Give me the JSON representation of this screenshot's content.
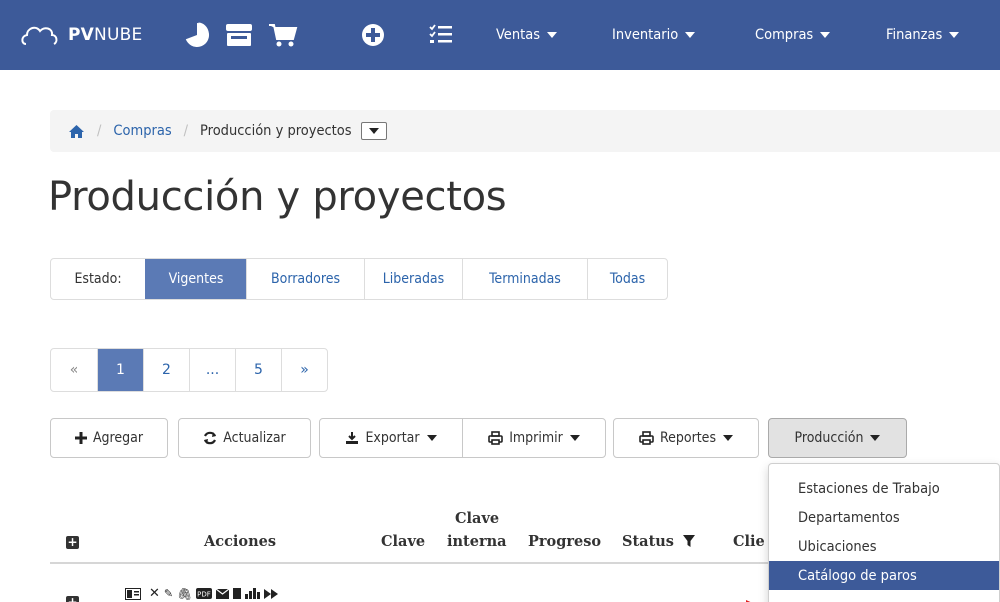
{
  "navbar": {
    "brand_strong": "PV",
    "brand_rest": "NUBE",
    "menus": [
      {
        "label": "Ventas"
      },
      {
        "label": "Inventario"
      },
      {
        "label": "Compras"
      },
      {
        "label": "Finanzas"
      }
    ],
    "colors": {
      "bar": "#3d5a99"
    }
  },
  "breadcrumb": {
    "items": [
      "Compras",
      "Producción y proyectos"
    ]
  },
  "page_title": "Producción y proyectos",
  "estado_filter": {
    "label": "Estado:",
    "options": [
      "Vigentes",
      "Borradores",
      "Liberadas",
      "Terminadas",
      "Todas"
    ],
    "selected": "Vigentes"
  },
  "pagination": {
    "prev": "«",
    "pages": [
      "1",
      "2",
      "...",
      "5"
    ],
    "next": "»",
    "current": "1"
  },
  "toolbar": {
    "agregar": "Agregar",
    "actualizar": "Actualizar",
    "exportar": "Exportar",
    "imprimir": "Imprimir",
    "reportes": "Reportes",
    "produccion": "Producción"
  },
  "produccion_menu": {
    "items": [
      "Estaciones de Trabajo",
      "Departamentos",
      "Ubicaciones",
      "Catálogo de paros"
    ],
    "highlighted": "Catálogo de paros"
  },
  "table": {
    "headers": {
      "acciones": "Acciones",
      "clave": "Clave",
      "clave_interna_1": "Clave",
      "clave_interna_2": "interna",
      "progreso": "Progreso",
      "status": "Status",
      "cliente_partial": "Clie"
    }
  }
}
